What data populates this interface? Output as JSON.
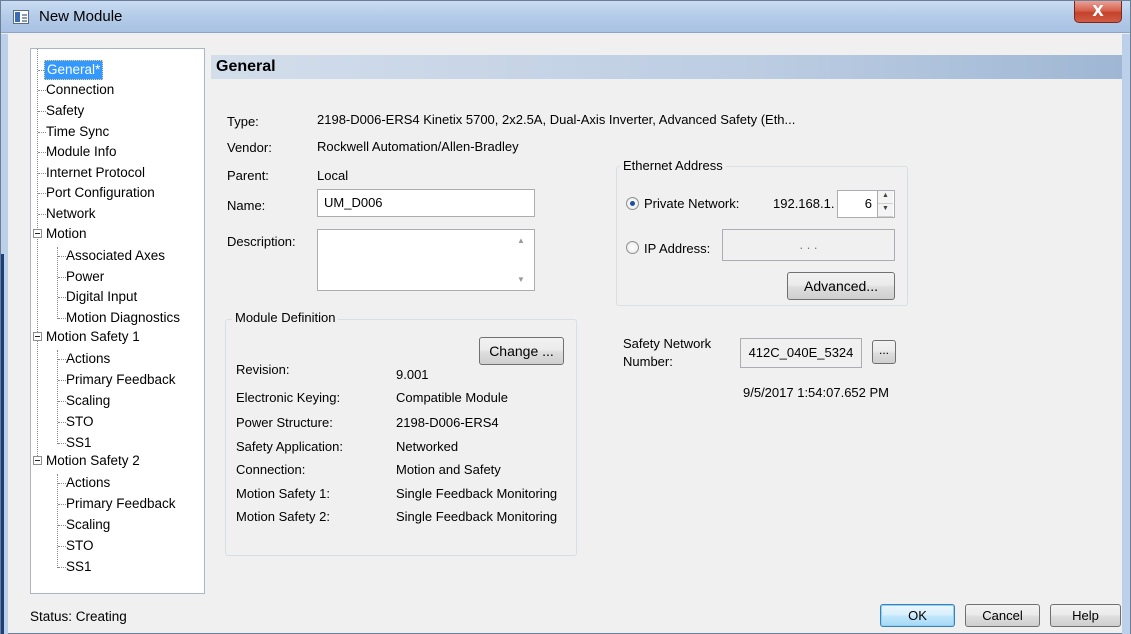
{
  "window": {
    "title": "New Module",
    "close_label": "X"
  },
  "tree": {
    "items": [
      {
        "label": "General*"
      },
      {
        "label": "Connection"
      },
      {
        "label": "Safety"
      },
      {
        "label": "Time Sync"
      },
      {
        "label": "Module Info"
      },
      {
        "label": "Internet Protocol"
      },
      {
        "label": "Port Configuration"
      },
      {
        "label": "Network"
      },
      {
        "label": "Motion"
      },
      {
        "label": "Associated Axes"
      },
      {
        "label": "Power"
      },
      {
        "label": "Digital Input"
      },
      {
        "label": "Motion Diagnostics"
      },
      {
        "label": "Motion Safety 1"
      },
      {
        "label": "Actions"
      },
      {
        "label": "Primary Feedback"
      },
      {
        "label": "Scaling"
      },
      {
        "label": "STO"
      },
      {
        "label": "SS1"
      },
      {
        "label": "Motion Safety 2"
      },
      {
        "label": "Actions"
      },
      {
        "label": "Primary Feedback"
      },
      {
        "label": "Scaling"
      },
      {
        "label": "STO"
      },
      {
        "label": "SS1"
      }
    ]
  },
  "general": {
    "header": "General",
    "type_label": "Type:",
    "type_value": "2198-D006-ERS4 Kinetix 5700, 2x2.5A, Dual-Axis Inverter, Advanced Safety (Eth...",
    "vendor_label": "Vendor:",
    "vendor_value": "Rockwell Automation/Allen-Bradley",
    "parent_label": "Parent:",
    "parent_value": "Local",
    "name_label": "Name:",
    "name_value": "UM_D006",
    "description_label": "Description:",
    "description_value": ""
  },
  "module_definition": {
    "title": "Module Definition",
    "change_button": "Change ...",
    "rows": [
      {
        "label": "Revision:",
        "value": "9.001"
      },
      {
        "label": "Electronic Keying:",
        "value": "Compatible Module"
      },
      {
        "label": "Power Structure:",
        "value": "2198-D006-ERS4"
      },
      {
        "label": "Safety Application:",
        "value": "Networked"
      },
      {
        "label": "Connection:",
        "value": "Motion and Safety"
      },
      {
        "label": "Motion Safety 1:",
        "value": "Single Feedback Monitoring"
      },
      {
        "label": "Motion Safety 2:",
        "value": "Single Feedback Monitoring"
      }
    ]
  },
  "ethernet": {
    "title": "Ethernet Address",
    "private_network_label": "Private Network:",
    "private_network_prefix": "192.168.1.",
    "private_network_octet": "6",
    "ip_address_label": "IP Address:",
    "ip_placeholder": ".          .          .",
    "advanced_button": "Advanced..."
  },
  "safety_network": {
    "label_line1": "Safety Network",
    "label_line2": "Number:",
    "value": "412C_040E_5324",
    "browse_button": "...",
    "timestamp": "9/5/2017 1:54:07.652 PM"
  },
  "status": {
    "text": "Status:  Creating"
  },
  "footer": {
    "ok": "OK",
    "cancel": "Cancel",
    "help": "Help"
  }
}
